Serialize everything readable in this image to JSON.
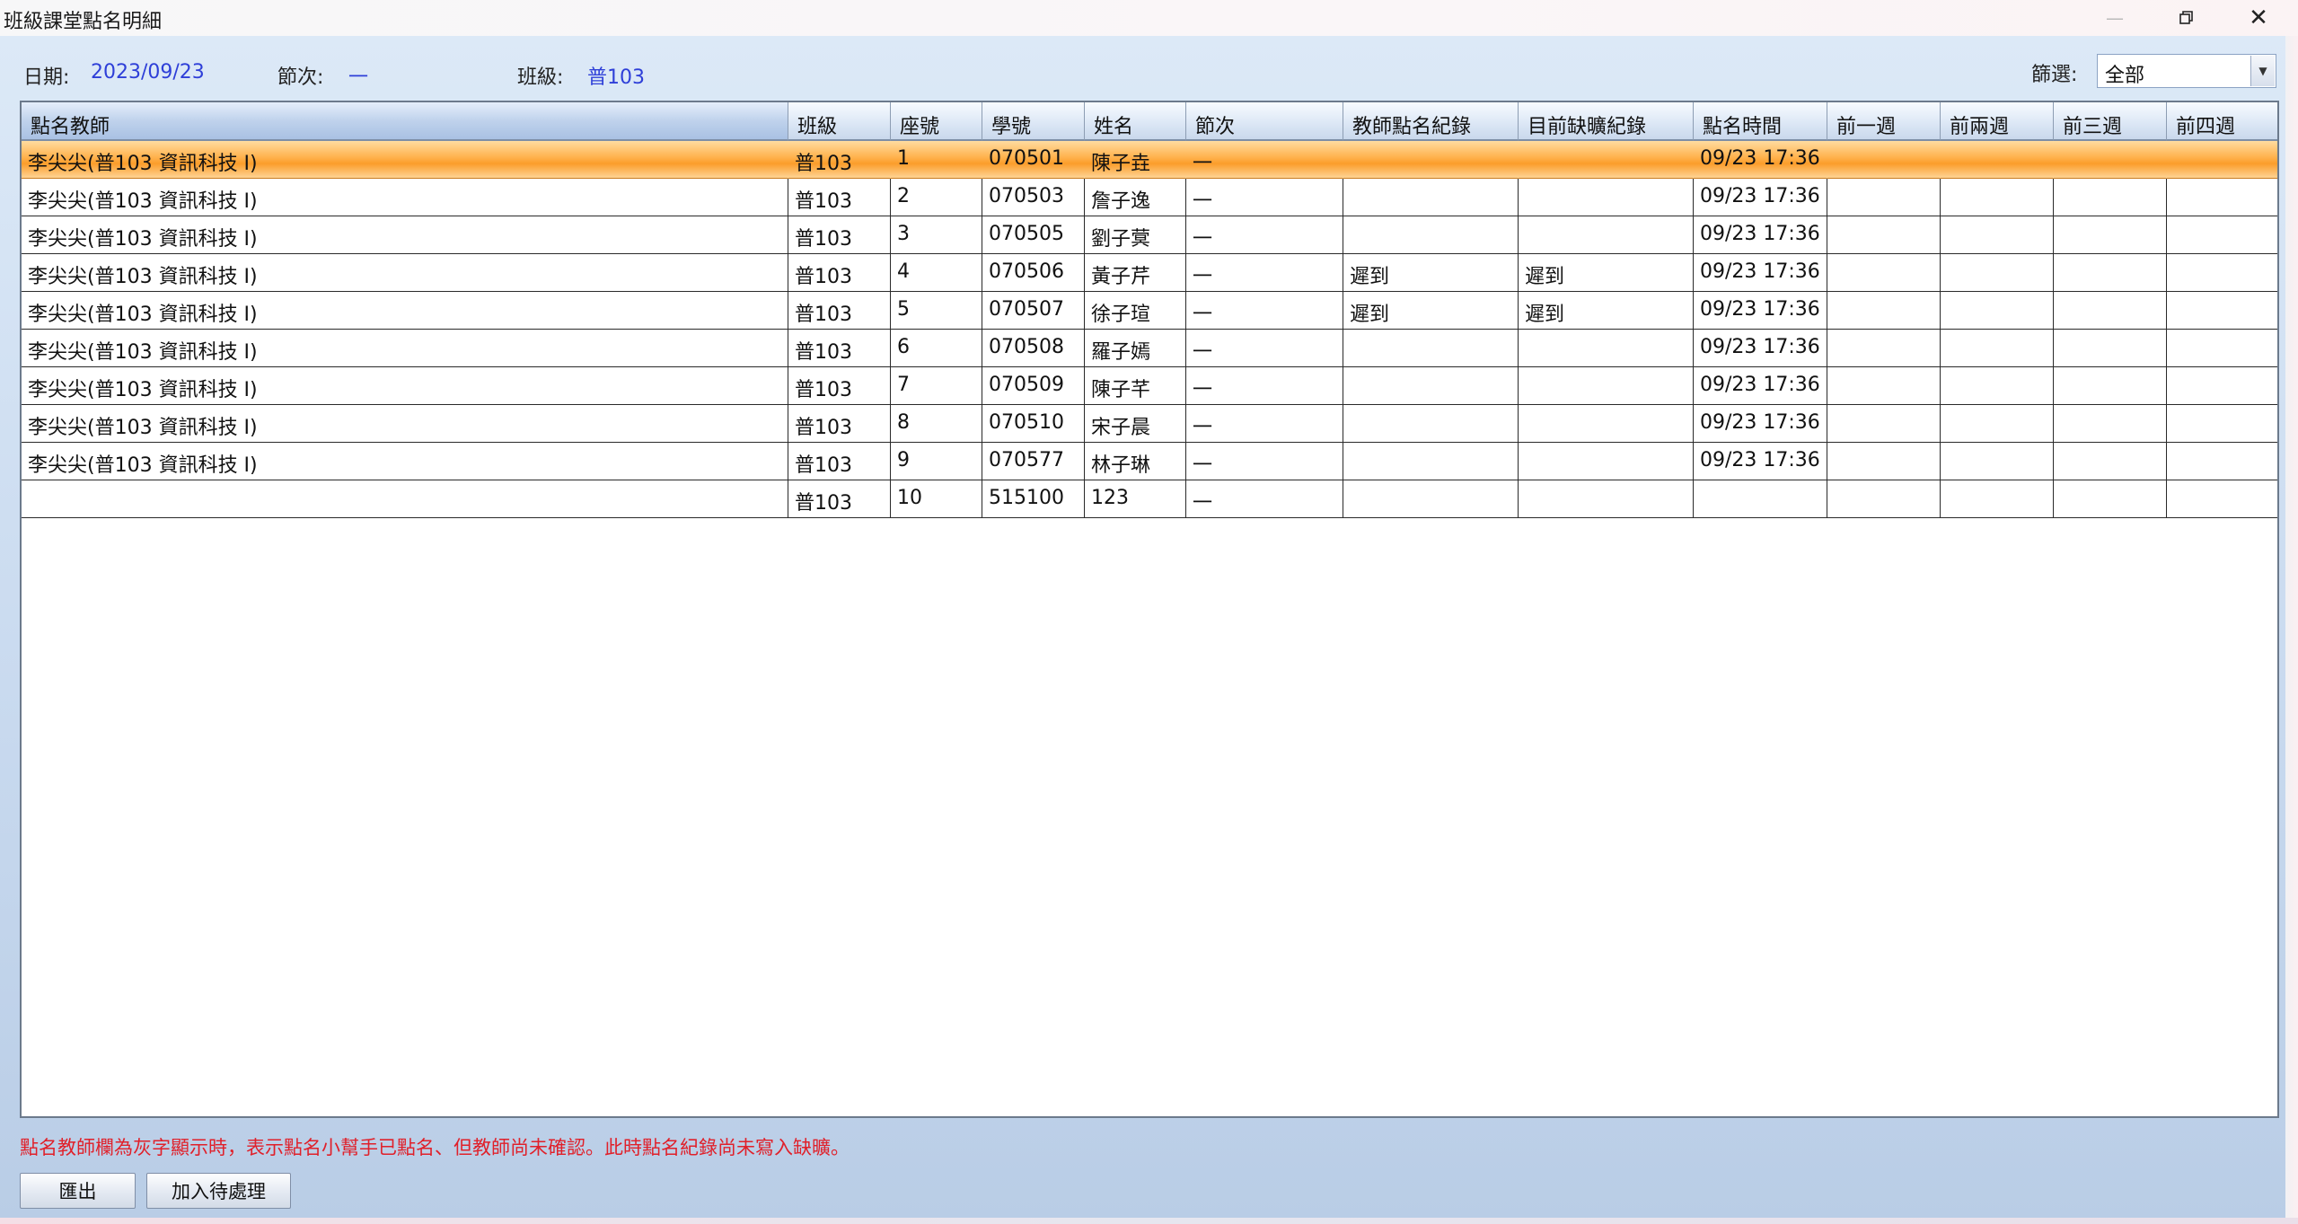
{
  "window": {
    "title": "班級課堂點名明細"
  },
  "header": {
    "date_label": "日期:",
    "date_value": "2023/09/23",
    "period_label": "節次:",
    "period_value": "一",
    "class_label": "班級:",
    "class_value": "普103",
    "filter_label": "篩選:",
    "filter_value": "全部"
  },
  "table": {
    "columns": [
      "點名教師",
      "班級",
      "座號",
      "學號",
      "姓名",
      "節次",
      "教師點名紀錄",
      "目前缺曠紀錄",
      "點名時間",
      "前一週",
      "前兩週",
      "前三週",
      "前四週"
    ],
    "rows": [
      [
        "李尖尖(普103 資訊科技 I)",
        "普103",
        "1",
        "070501",
        "陳子垚",
        "一",
        "",
        "",
        "09/23 17:36",
        "",
        "",
        "",
        ""
      ],
      [
        "李尖尖(普103 資訊科技 I)",
        "普103",
        "2",
        "070503",
        "詹子逸",
        "一",
        "",
        "",
        "09/23 17:36",
        "",
        "",
        "",
        ""
      ],
      [
        "李尖尖(普103 資訊科技 I)",
        "普103",
        "3",
        "070505",
        "劉子蓂",
        "一",
        "",
        "",
        "09/23 17:36",
        "",
        "",
        "",
        ""
      ],
      [
        "李尖尖(普103 資訊科技 I)",
        "普103",
        "4",
        "070506",
        "黃子芹",
        "一",
        "遲到",
        "遲到",
        "09/23 17:36",
        "",
        "",
        "",
        ""
      ],
      [
        "李尖尖(普103 資訊科技 I)",
        "普103",
        "5",
        "070507",
        "徐子瑄",
        "一",
        "遲到",
        "遲到",
        "09/23 17:36",
        "",
        "",
        "",
        ""
      ],
      [
        "李尖尖(普103 資訊科技 I)",
        "普103",
        "6",
        "070508",
        "羅子嫣",
        "一",
        "",
        "",
        "09/23 17:36",
        "",
        "",
        "",
        ""
      ],
      [
        "李尖尖(普103 資訊科技 I)",
        "普103",
        "7",
        "070509",
        "陳子芊",
        "一",
        "",
        "",
        "09/23 17:36",
        "",
        "",
        "",
        ""
      ],
      [
        "李尖尖(普103 資訊科技 I)",
        "普103",
        "8",
        "070510",
        "宋子晨",
        "一",
        "",
        "",
        "09/23 17:36",
        "",
        "",
        "",
        ""
      ],
      [
        "李尖尖(普103 資訊科技 I)",
        "普103",
        "9",
        "070577",
        "林子琳",
        "一",
        "",
        "",
        "09/23 17:36",
        "",
        "",
        "",
        ""
      ],
      [
        "",
        "普103",
        "10",
        "515100",
        "123",
        "一",
        "",
        "",
        "",
        "",
        "",
        "",
        ""
      ]
    ]
  },
  "note": "點名教師欄為灰字顯示時，表示點名小幫手已點名、但教師尚未確認。此時點名紀錄尚未寫入缺曠。",
  "buttons": {
    "export": "匯出",
    "add_pending": "加入待處理"
  }
}
